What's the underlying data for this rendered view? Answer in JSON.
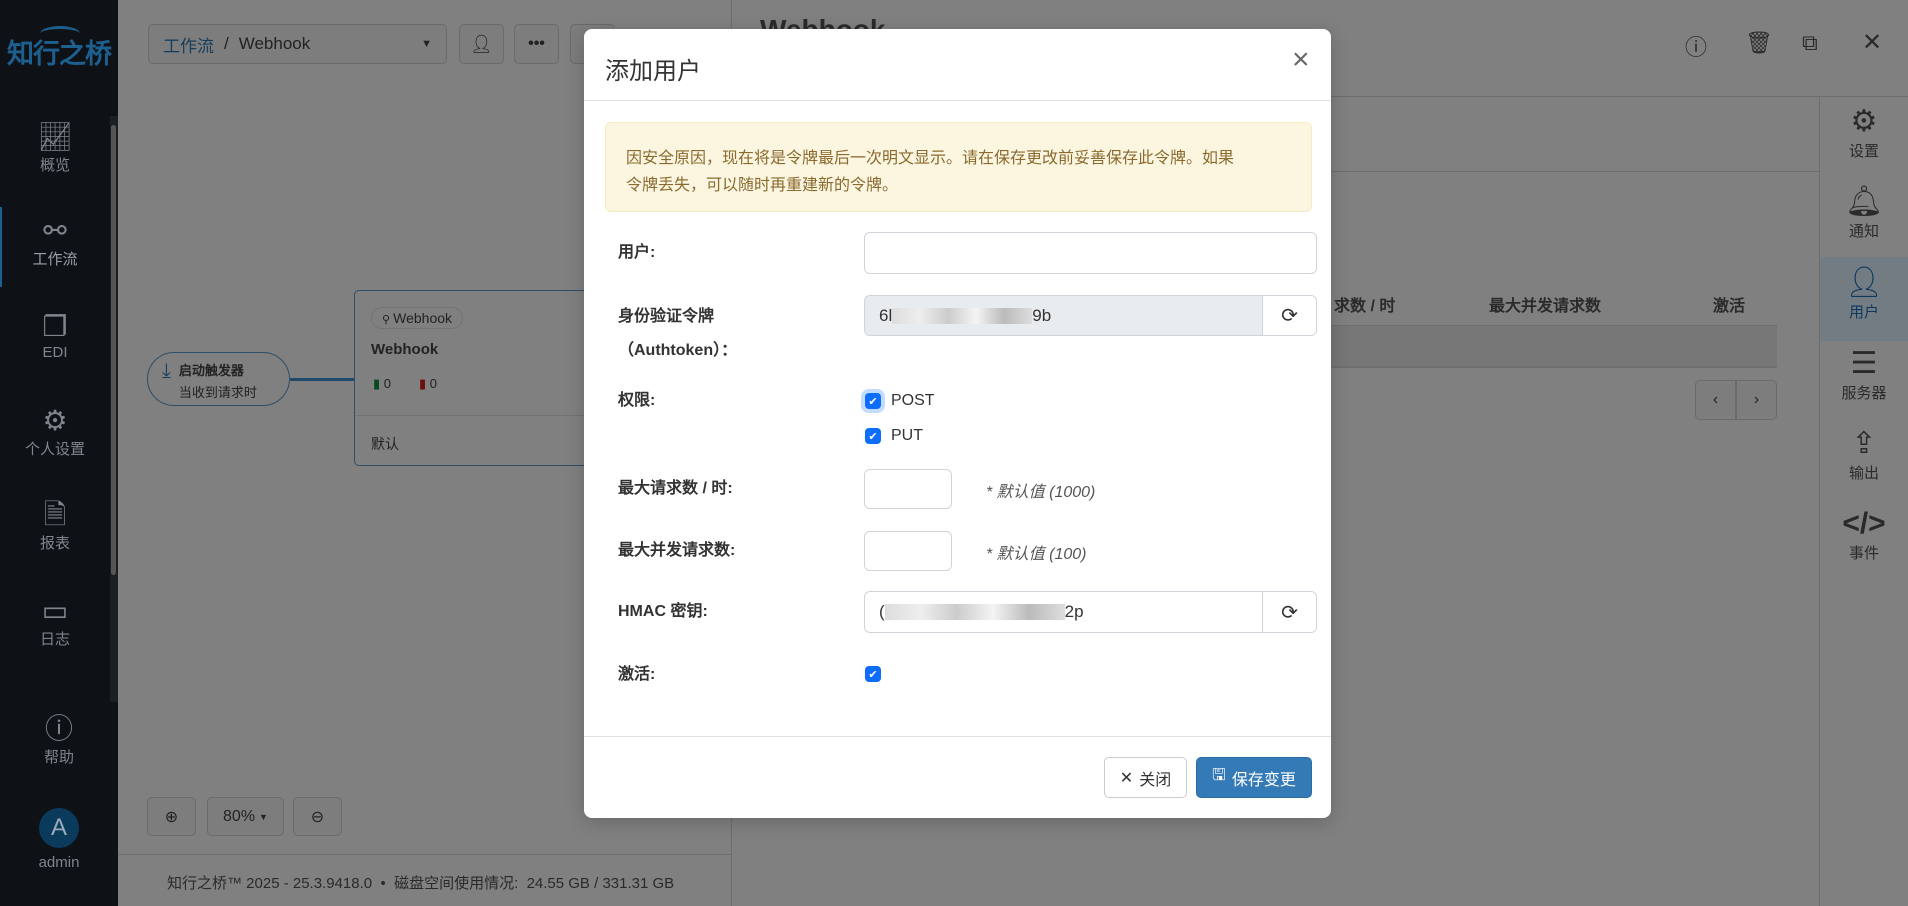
{
  "sidebar": {
    "logo": "知行之桥",
    "items": [
      {
        "label": "概览",
        "icon": "chart-line-icon"
      },
      {
        "label": "工作流",
        "icon": "share-nodes-icon",
        "active": true
      },
      {
        "label": "EDI",
        "icon": "copy-icon"
      },
      {
        "label": "个人设置",
        "icon": "gears-icon"
      },
      {
        "label": "报表",
        "icon": "file-lines-icon"
      },
      {
        "label": "日志",
        "icon": "layer-icon"
      }
    ],
    "help": "帮助",
    "avatar_initial": "A",
    "user": "admin"
  },
  "breadcrumb": {
    "parent": "工作流",
    "separator": "/",
    "current": "Webhook"
  },
  "canvas": {
    "trigger_title": "启动触发器",
    "trigger_sub": "当收到请求时",
    "card_badge": "Webhook",
    "card_title": "Webhook",
    "success_count": "0",
    "error_count": "0",
    "card_footer": "默认",
    "zoom": "80%"
  },
  "footer": {
    "text": "知行之桥™ 2025 - 25.3.9418.0",
    "bullet": "•",
    "disk": "磁盘空间使用情况:  24.55 GB / 331.31 GB"
  },
  "right_panel": {
    "title": "Webhook",
    "table_headers": [
      "求数 / 时",
      "最大并发请求数",
      "激活"
    ],
    "tabs": [
      {
        "label": "设置",
        "icon": "gear-icon"
      },
      {
        "label": "通知",
        "icon": "bell-icon"
      },
      {
        "label": "用户",
        "icon": "user-icon",
        "active": true
      },
      {
        "label": "服务器",
        "icon": "server-icon"
      },
      {
        "label": "输出",
        "icon": "upload-icon"
      },
      {
        "label": "事件",
        "icon": "code-icon"
      }
    ]
  },
  "dialog": {
    "title": "添加用户",
    "alert": "因安全原因，现在将是令牌最后一次明文显示。请在保存更改前妥善保存此令牌。如果令牌丢失，可以随时再重建新的令牌。",
    "alert_line1": "因安全原因，现在将是令牌最后一次明文显示。请在保存更改前妥善保存此令牌。如果",
    "alert_line2": "令牌丢失，可以随时再重建新的令牌。",
    "user_label": "用户:",
    "user_value": "",
    "token_label1": "身份验证令牌",
    "token_label2": "（Authtoken）：",
    "token_prefix": "6l",
    "token_suffix": "9b",
    "perm_label": "权限:",
    "perm_post": "POST",
    "perm_put": "PUT",
    "post_checked": true,
    "put_checked": true,
    "max_req_label": "最大请求数 / 时:",
    "max_req_hint": "* 默认值 (1000)",
    "max_conc_label": "最大并发请求数:",
    "max_conc_hint": "* 默认值 (100)",
    "hmac_label": "HMAC 密钥:",
    "hmac_prefix": "(",
    "hmac_suffix": "2p",
    "active_label": "激活:",
    "active_checked": true,
    "close_label": "关闭",
    "save_label": "保存变更"
  },
  "colors": {
    "primary": "#337ab7",
    "checkbox": "#0d6efd",
    "alert_bg": "#fcf6e1",
    "sidebar_bg": "#0e1217"
  }
}
